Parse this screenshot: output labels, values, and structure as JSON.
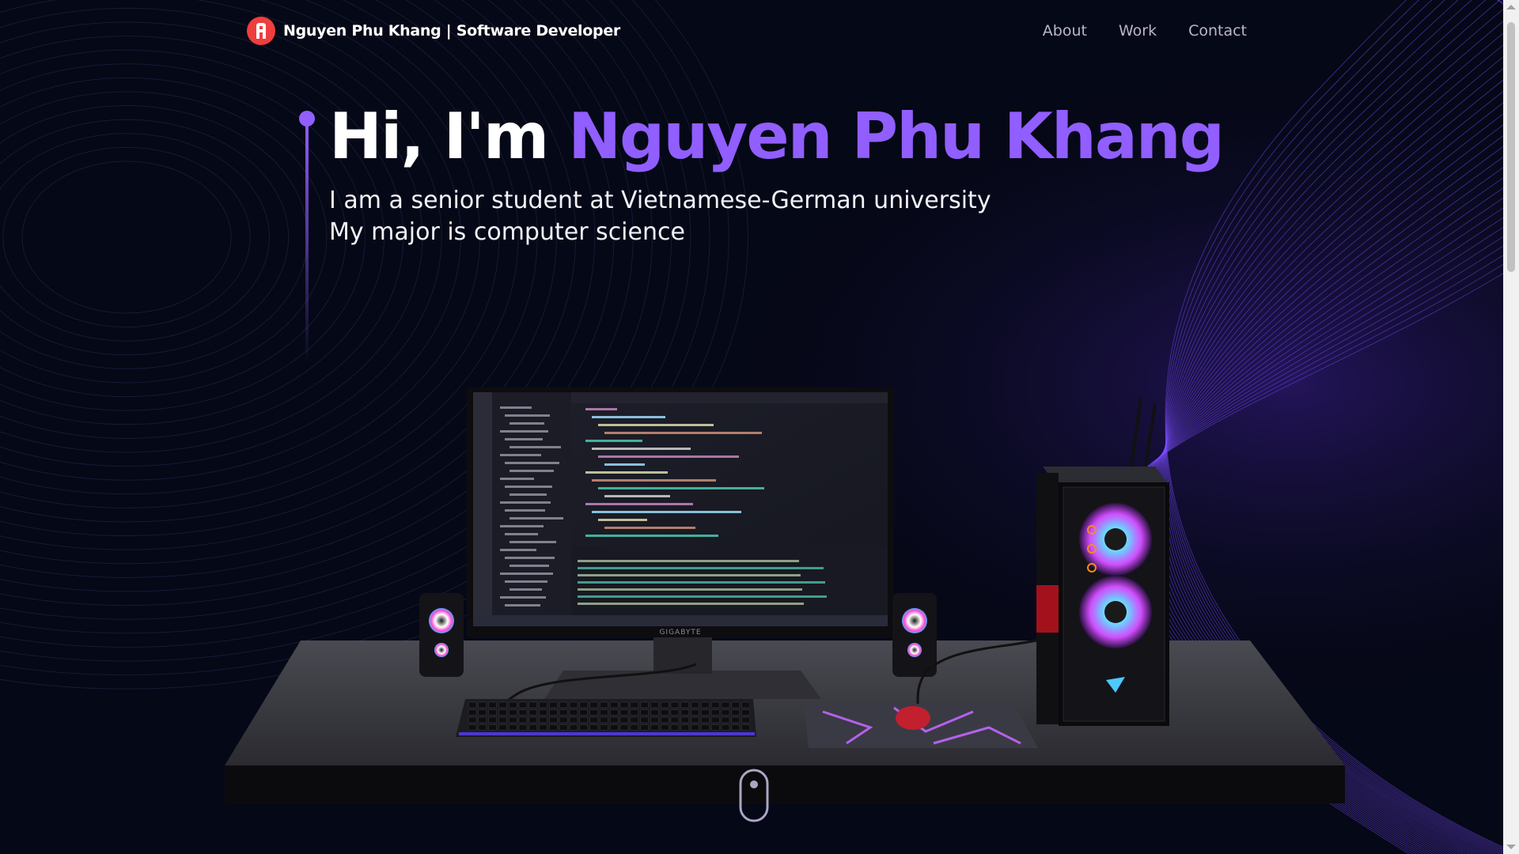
{
  "nav": {
    "brand_name": "Nguyen Phu Khang | Software Developer",
    "links": [
      {
        "label": "About"
      },
      {
        "label": "Work"
      },
      {
        "label": "Contact"
      }
    ]
  },
  "hero": {
    "greeting": "Hi, I'm ",
    "name": "Nguyen Phu Khang",
    "lines": [
      "I am a senior student at Vietnamese-German university",
      "My major is computer science"
    ]
  },
  "scene": {
    "monitor_brand": "GIGABYTE"
  },
  "icons": {
    "logo": "logo-icon",
    "scroll": "mouse-scroll-icon"
  },
  "colors": {
    "background": "#050816",
    "accent": "#915eff",
    "logo": "#ef3e3e",
    "nav_text": "#b9b6c9"
  }
}
